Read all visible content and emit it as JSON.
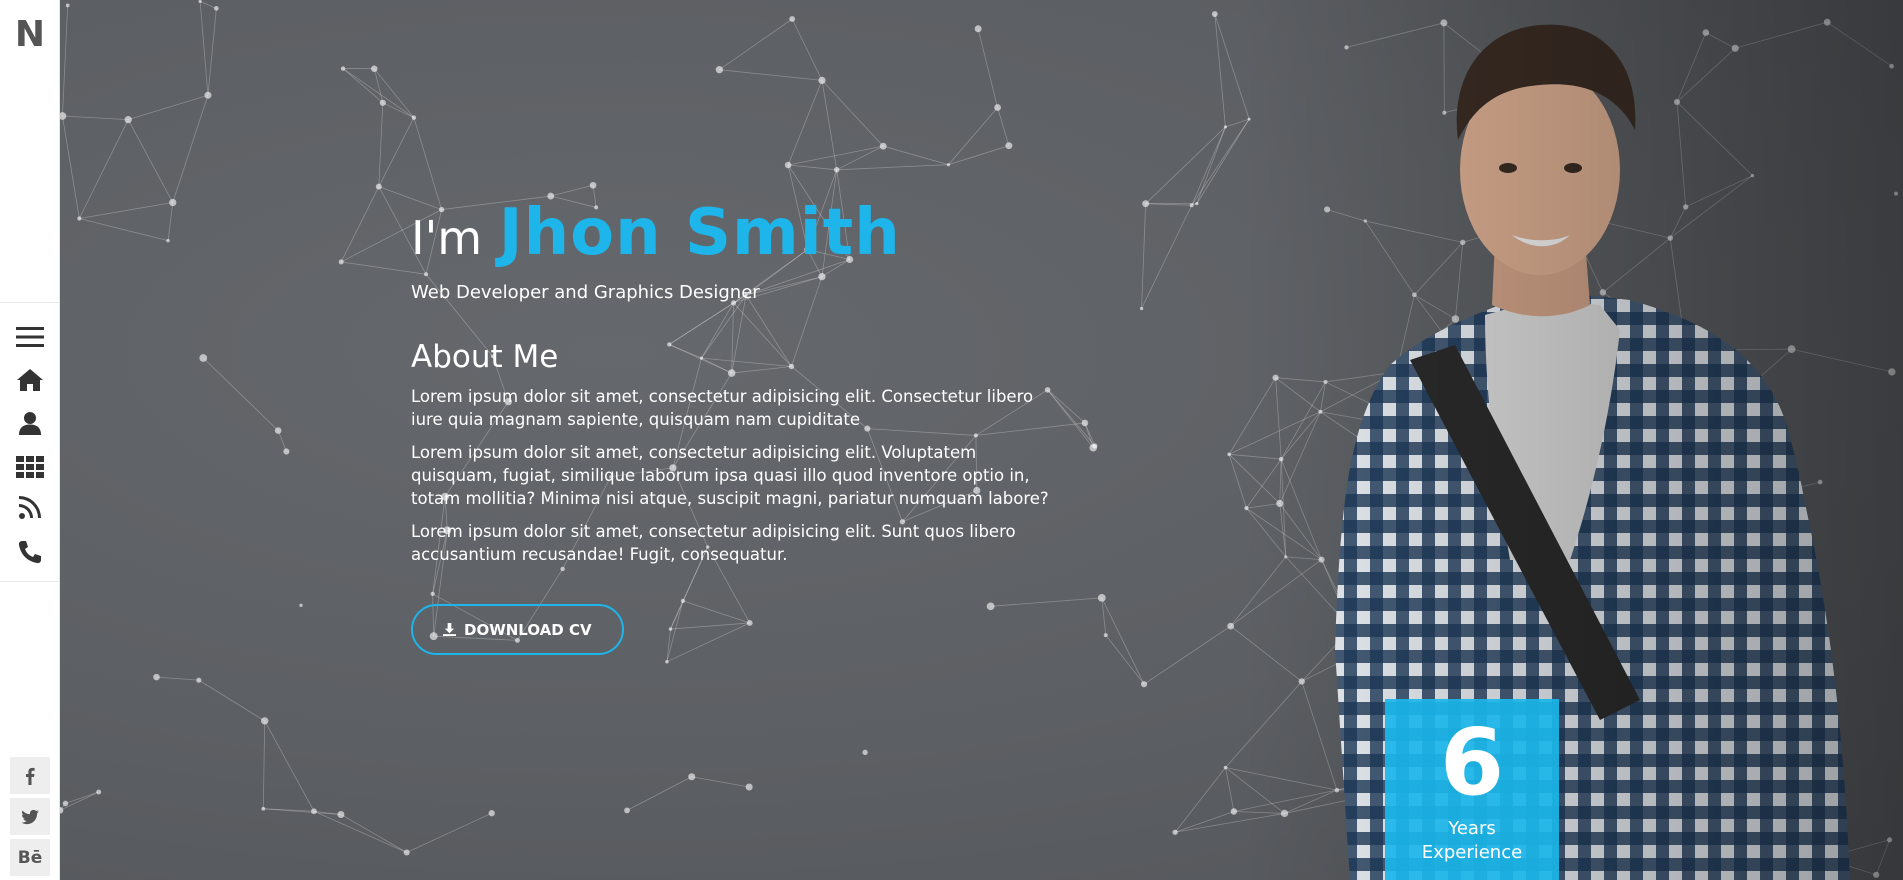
{
  "sidebar": {
    "logo": "N",
    "nav_items": [
      {
        "icon": "menu-icon"
      },
      {
        "icon": "home-icon"
      },
      {
        "icon": "user-icon"
      },
      {
        "icon": "grid-icon"
      },
      {
        "icon": "rss-icon"
      },
      {
        "icon": "phone-icon"
      }
    ],
    "social": [
      {
        "icon": "facebook-icon"
      },
      {
        "icon": "twitter-icon"
      },
      {
        "icon": "behance-icon",
        "label": "Bē"
      }
    ]
  },
  "hero": {
    "greeting": "I'm",
    "name": "Jhon Smith",
    "tagline": "Web Developer and Graphics Designer",
    "about_title": "About Me",
    "paragraphs": [
      "Lorem ipsum dolor sit amet, consectetur adipisicing elit. Consectetur libero iure quia magnam sapiente, quisquam nam cupiditate",
      "Lorem ipsum dolor sit amet, consectetur adipisicing elit. Voluptatem quisquam, fugiat, similique laborum ipsa quasi illo quod inventore optio in, totam mollitia? Minima nisi atque, suscipit magni, pariatur numquam labore?",
      "Lorem ipsum dolor sit amet, consectetur adipisicing elit. Sunt quos libero accusantium recusandae! Fugit, consequatur."
    ],
    "download_label": "DOWNLOAD CV"
  },
  "experience": {
    "number": "6",
    "label": "Years Experience"
  },
  "colors": {
    "accent": "#1db5ea",
    "background": "#5a5d61",
    "sidebar": "#ffffff"
  }
}
